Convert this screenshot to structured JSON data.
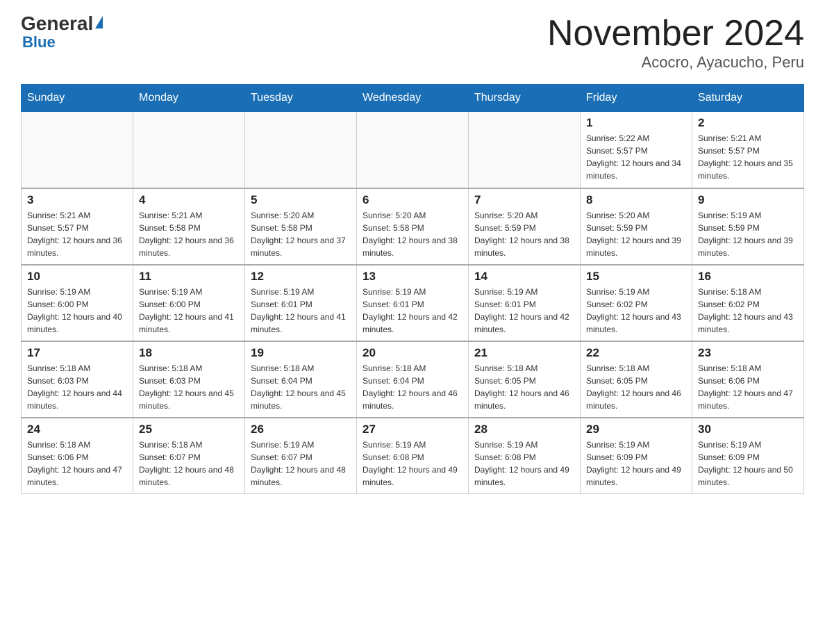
{
  "header": {
    "logo_general": "General",
    "logo_blue": "Blue",
    "month_title": "November 2024",
    "location": "Acocro, Ayacucho, Peru"
  },
  "weekdays": [
    "Sunday",
    "Monday",
    "Tuesday",
    "Wednesday",
    "Thursday",
    "Friday",
    "Saturday"
  ],
  "weeks": [
    [
      {
        "day": "",
        "sunrise": "",
        "sunset": "",
        "daylight": ""
      },
      {
        "day": "",
        "sunrise": "",
        "sunset": "",
        "daylight": ""
      },
      {
        "day": "",
        "sunrise": "",
        "sunset": "",
        "daylight": ""
      },
      {
        "day": "",
        "sunrise": "",
        "sunset": "",
        "daylight": ""
      },
      {
        "day": "",
        "sunrise": "",
        "sunset": "",
        "daylight": ""
      },
      {
        "day": "1",
        "sunrise": "Sunrise: 5:22 AM",
        "sunset": "Sunset: 5:57 PM",
        "daylight": "Daylight: 12 hours and 34 minutes."
      },
      {
        "day": "2",
        "sunrise": "Sunrise: 5:21 AM",
        "sunset": "Sunset: 5:57 PM",
        "daylight": "Daylight: 12 hours and 35 minutes."
      }
    ],
    [
      {
        "day": "3",
        "sunrise": "Sunrise: 5:21 AM",
        "sunset": "Sunset: 5:57 PM",
        "daylight": "Daylight: 12 hours and 36 minutes."
      },
      {
        "day": "4",
        "sunrise": "Sunrise: 5:21 AM",
        "sunset": "Sunset: 5:58 PM",
        "daylight": "Daylight: 12 hours and 36 minutes."
      },
      {
        "day": "5",
        "sunrise": "Sunrise: 5:20 AM",
        "sunset": "Sunset: 5:58 PM",
        "daylight": "Daylight: 12 hours and 37 minutes."
      },
      {
        "day": "6",
        "sunrise": "Sunrise: 5:20 AM",
        "sunset": "Sunset: 5:58 PM",
        "daylight": "Daylight: 12 hours and 38 minutes."
      },
      {
        "day": "7",
        "sunrise": "Sunrise: 5:20 AM",
        "sunset": "Sunset: 5:59 PM",
        "daylight": "Daylight: 12 hours and 38 minutes."
      },
      {
        "day": "8",
        "sunrise": "Sunrise: 5:20 AM",
        "sunset": "Sunset: 5:59 PM",
        "daylight": "Daylight: 12 hours and 39 minutes."
      },
      {
        "day": "9",
        "sunrise": "Sunrise: 5:19 AM",
        "sunset": "Sunset: 5:59 PM",
        "daylight": "Daylight: 12 hours and 39 minutes."
      }
    ],
    [
      {
        "day": "10",
        "sunrise": "Sunrise: 5:19 AM",
        "sunset": "Sunset: 6:00 PM",
        "daylight": "Daylight: 12 hours and 40 minutes."
      },
      {
        "day": "11",
        "sunrise": "Sunrise: 5:19 AM",
        "sunset": "Sunset: 6:00 PM",
        "daylight": "Daylight: 12 hours and 41 minutes."
      },
      {
        "day": "12",
        "sunrise": "Sunrise: 5:19 AM",
        "sunset": "Sunset: 6:01 PM",
        "daylight": "Daylight: 12 hours and 41 minutes."
      },
      {
        "day": "13",
        "sunrise": "Sunrise: 5:19 AM",
        "sunset": "Sunset: 6:01 PM",
        "daylight": "Daylight: 12 hours and 42 minutes."
      },
      {
        "day": "14",
        "sunrise": "Sunrise: 5:19 AM",
        "sunset": "Sunset: 6:01 PM",
        "daylight": "Daylight: 12 hours and 42 minutes."
      },
      {
        "day": "15",
        "sunrise": "Sunrise: 5:19 AM",
        "sunset": "Sunset: 6:02 PM",
        "daylight": "Daylight: 12 hours and 43 minutes."
      },
      {
        "day": "16",
        "sunrise": "Sunrise: 5:18 AM",
        "sunset": "Sunset: 6:02 PM",
        "daylight": "Daylight: 12 hours and 43 minutes."
      }
    ],
    [
      {
        "day": "17",
        "sunrise": "Sunrise: 5:18 AM",
        "sunset": "Sunset: 6:03 PM",
        "daylight": "Daylight: 12 hours and 44 minutes."
      },
      {
        "day": "18",
        "sunrise": "Sunrise: 5:18 AM",
        "sunset": "Sunset: 6:03 PM",
        "daylight": "Daylight: 12 hours and 45 minutes."
      },
      {
        "day": "19",
        "sunrise": "Sunrise: 5:18 AM",
        "sunset": "Sunset: 6:04 PM",
        "daylight": "Daylight: 12 hours and 45 minutes."
      },
      {
        "day": "20",
        "sunrise": "Sunrise: 5:18 AM",
        "sunset": "Sunset: 6:04 PM",
        "daylight": "Daylight: 12 hours and 46 minutes."
      },
      {
        "day": "21",
        "sunrise": "Sunrise: 5:18 AM",
        "sunset": "Sunset: 6:05 PM",
        "daylight": "Daylight: 12 hours and 46 minutes."
      },
      {
        "day": "22",
        "sunrise": "Sunrise: 5:18 AM",
        "sunset": "Sunset: 6:05 PM",
        "daylight": "Daylight: 12 hours and 46 minutes."
      },
      {
        "day": "23",
        "sunrise": "Sunrise: 5:18 AM",
        "sunset": "Sunset: 6:06 PM",
        "daylight": "Daylight: 12 hours and 47 minutes."
      }
    ],
    [
      {
        "day": "24",
        "sunrise": "Sunrise: 5:18 AM",
        "sunset": "Sunset: 6:06 PM",
        "daylight": "Daylight: 12 hours and 47 minutes."
      },
      {
        "day": "25",
        "sunrise": "Sunrise: 5:18 AM",
        "sunset": "Sunset: 6:07 PM",
        "daylight": "Daylight: 12 hours and 48 minutes."
      },
      {
        "day": "26",
        "sunrise": "Sunrise: 5:19 AM",
        "sunset": "Sunset: 6:07 PM",
        "daylight": "Daylight: 12 hours and 48 minutes."
      },
      {
        "day": "27",
        "sunrise": "Sunrise: 5:19 AM",
        "sunset": "Sunset: 6:08 PM",
        "daylight": "Daylight: 12 hours and 49 minutes."
      },
      {
        "day": "28",
        "sunrise": "Sunrise: 5:19 AM",
        "sunset": "Sunset: 6:08 PM",
        "daylight": "Daylight: 12 hours and 49 minutes."
      },
      {
        "day": "29",
        "sunrise": "Sunrise: 5:19 AM",
        "sunset": "Sunset: 6:09 PM",
        "daylight": "Daylight: 12 hours and 49 minutes."
      },
      {
        "day": "30",
        "sunrise": "Sunrise: 5:19 AM",
        "sunset": "Sunset: 6:09 PM",
        "daylight": "Daylight: 12 hours and 50 minutes."
      }
    ]
  ]
}
